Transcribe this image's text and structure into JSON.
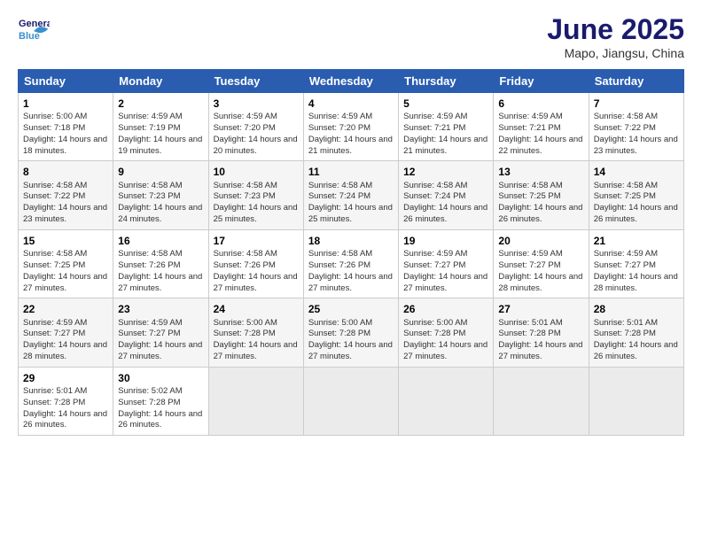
{
  "header": {
    "logo_line1": "General",
    "logo_line2": "Blue",
    "title": "June 2025",
    "subtitle": "Mapo, Jiangsu, China"
  },
  "days_of_week": [
    "Sunday",
    "Monday",
    "Tuesday",
    "Wednesday",
    "Thursday",
    "Friday",
    "Saturday"
  ],
  "weeks": [
    [
      {
        "day": "1",
        "rise": "5:00 AM",
        "set": "7:18 PM",
        "hours": "14 hours and 18 minutes."
      },
      {
        "day": "2",
        "rise": "4:59 AM",
        "set": "7:19 PM",
        "hours": "14 hours and 19 minutes."
      },
      {
        "day": "3",
        "rise": "4:59 AM",
        "set": "7:20 PM",
        "hours": "14 hours and 20 minutes."
      },
      {
        "day": "4",
        "rise": "4:59 AM",
        "set": "7:20 PM",
        "hours": "14 hours and 21 minutes."
      },
      {
        "day": "5",
        "rise": "4:59 AM",
        "set": "7:21 PM",
        "hours": "14 hours and 21 minutes."
      },
      {
        "day": "6",
        "rise": "4:59 AM",
        "set": "7:21 PM",
        "hours": "14 hours and 22 minutes."
      },
      {
        "day": "7",
        "rise": "4:58 AM",
        "set": "7:22 PM",
        "hours": "14 hours and 23 minutes."
      }
    ],
    [
      {
        "day": "8",
        "rise": "4:58 AM",
        "set": "7:22 PM",
        "hours": "14 hours and 23 minutes."
      },
      {
        "day": "9",
        "rise": "4:58 AM",
        "set": "7:23 PM",
        "hours": "14 hours and 24 minutes."
      },
      {
        "day": "10",
        "rise": "4:58 AM",
        "set": "7:23 PM",
        "hours": "14 hours and 25 minutes."
      },
      {
        "day": "11",
        "rise": "4:58 AM",
        "set": "7:24 PM",
        "hours": "14 hours and 25 minutes."
      },
      {
        "day": "12",
        "rise": "4:58 AM",
        "set": "7:24 PM",
        "hours": "14 hours and 26 minutes."
      },
      {
        "day": "13",
        "rise": "4:58 AM",
        "set": "7:25 PM",
        "hours": "14 hours and 26 minutes."
      },
      {
        "day": "14",
        "rise": "4:58 AM",
        "set": "7:25 PM",
        "hours": "14 hours and 26 minutes."
      }
    ],
    [
      {
        "day": "15",
        "rise": "4:58 AM",
        "set": "7:25 PM",
        "hours": "14 hours and 27 minutes."
      },
      {
        "day": "16",
        "rise": "4:58 AM",
        "set": "7:26 PM",
        "hours": "14 hours and 27 minutes."
      },
      {
        "day": "17",
        "rise": "4:58 AM",
        "set": "7:26 PM",
        "hours": "14 hours and 27 minutes."
      },
      {
        "day": "18",
        "rise": "4:58 AM",
        "set": "7:26 PM",
        "hours": "14 hours and 27 minutes."
      },
      {
        "day": "19",
        "rise": "4:59 AM",
        "set": "7:27 PM",
        "hours": "14 hours and 27 minutes."
      },
      {
        "day": "20",
        "rise": "4:59 AM",
        "set": "7:27 PM",
        "hours": "14 hours and 28 minutes."
      },
      {
        "day": "21",
        "rise": "4:59 AM",
        "set": "7:27 PM",
        "hours": "14 hours and 28 minutes."
      }
    ],
    [
      {
        "day": "22",
        "rise": "4:59 AM",
        "set": "7:27 PM",
        "hours": "14 hours and 28 minutes."
      },
      {
        "day": "23",
        "rise": "4:59 AM",
        "set": "7:27 PM",
        "hours": "14 hours and 27 minutes."
      },
      {
        "day": "24",
        "rise": "5:00 AM",
        "set": "7:28 PM",
        "hours": "14 hours and 27 minutes."
      },
      {
        "day": "25",
        "rise": "5:00 AM",
        "set": "7:28 PM",
        "hours": "14 hours and 27 minutes."
      },
      {
        "day": "26",
        "rise": "5:00 AM",
        "set": "7:28 PM",
        "hours": "14 hours and 27 minutes."
      },
      {
        "day": "27",
        "rise": "5:01 AM",
        "set": "7:28 PM",
        "hours": "14 hours and 27 minutes."
      },
      {
        "day": "28",
        "rise": "5:01 AM",
        "set": "7:28 PM",
        "hours": "14 hours and 26 minutes."
      }
    ],
    [
      {
        "day": "29",
        "rise": "5:01 AM",
        "set": "7:28 PM",
        "hours": "14 hours and 26 minutes."
      },
      {
        "day": "30",
        "rise": "5:02 AM",
        "set": "7:28 PM",
        "hours": "14 hours and 26 minutes."
      },
      null,
      null,
      null,
      null,
      null
    ]
  ]
}
